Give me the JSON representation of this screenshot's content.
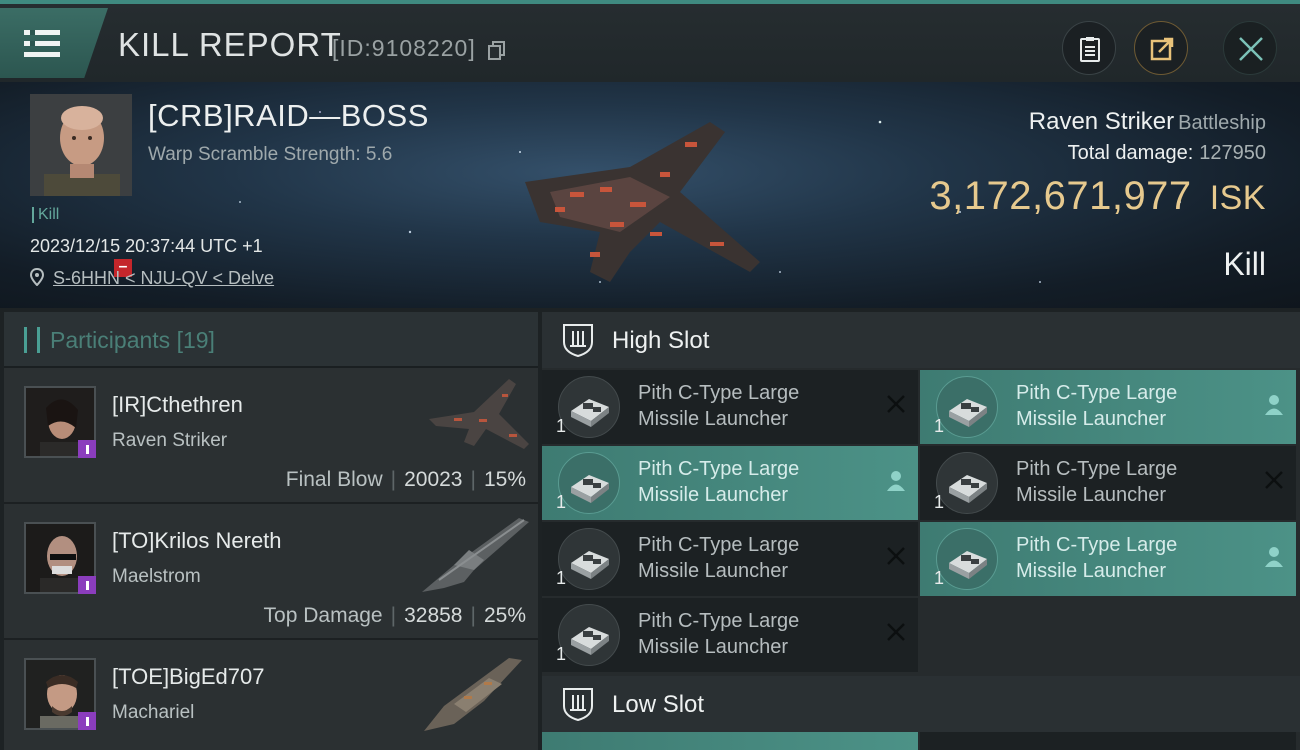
{
  "header": {
    "title": "KILL REPORT",
    "report_id": "[ID:9108220]"
  },
  "victim": {
    "name": "[CRB]RAID—BOSS",
    "warp_scramble": "Warp Scramble Strength: 5.6",
    "kill_tag": "Kill",
    "datetime": "2023/12/15 20:37:44 UTC +1",
    "location": "S-6HHN < NJU-QV < Delve",
    "ship_name": "Raven Striker",
    "ship_class": "Battleship",
    "total_damage_label": "Total damage:",
    "total_damage_value": "127950",
    "isk_value": "3,172,671,977",
    "isk_unit": "ISK",
    "result": "Kill"
  },
  "participants": {
    "title": "Participants",
    "count": "[19]",
    "rows": [
      {
        "name": "[IR]Cthethren",
        "ship": "Raven Striker",
        "tag": "Final Blow",
        "damage": "20023",
        "percent": "15%"
      },
      {
        "name": "[TO]Krilos Nereth",
        "ship": "Maelstrom",
        "tag": "Top Damage",
        "damage": "32858",
        "percent": "25%"
      },
      {
        "name": "[TOE]BigEd707",
        "ship": "Machariel",
        "tag": "",
        "damage": "",
        "percent": ""
      }
    ]
  },
  "slots": {
    "high_label": "High Slot",
    "low_label": "Low Slot",
    "modules": [
      {
        "name_line1": "Pith C-Type Large",
        "name_line2": "Missile Launcher",
        "qty": "1",
        "state": "destroyed"
      },
      {
        "name_line1": "Pith C-Type Large",
        "name_line2": "Missile Launcher",
        "qty": "1",
        "state": "dropped"
      },
      {
        "name_line1": "Pith C-Type Large",
        "name_line2": "Missile Launcher",
        "qty": "1",
        "state": "dropped"
      },
      {
        "name_line1": "Pith C-Type Large",
        "name_line2": "Missile Launcher",
        "qty": "1",
        "state": "destroyed"
      },
      {
        "name_line1": "Pith C-Type Large",
        "name_line2": "Missile Launcher",
        "qty": "1",
        "state": "destroyed"
      },
      {
        "name_line1": "Pith C-Type Large",
        "name_line2": "Missile Launcher",
        "qty": "1",
        "state": "dropped"
      },
      {
        "name_line1": "Pith C-Type Large",
        "name_line2": "Missile Launcher",
        "qty": "1",
        "state": "destroyed"
      }
    ]
  },
  "colors": {
    "accent": "#4c9287",
    "isk": "#e6c98e",
    "security_badge": "#c4262b",
    "participant_badge": "#8b3dbd"
  },
  "icons": {
    "menu": "hamburger-menu-icon",
    "copy": "copy-icon",
    "clipboard": "clipboard-icon",
    "share": "share-icon",
    "close": "close-icon",
    "location": "location-pin-icon",
    "slot": "high-slot-icon",
    "destroyed": "x-icon",
    "dropped": "person-icon"
  }
}
